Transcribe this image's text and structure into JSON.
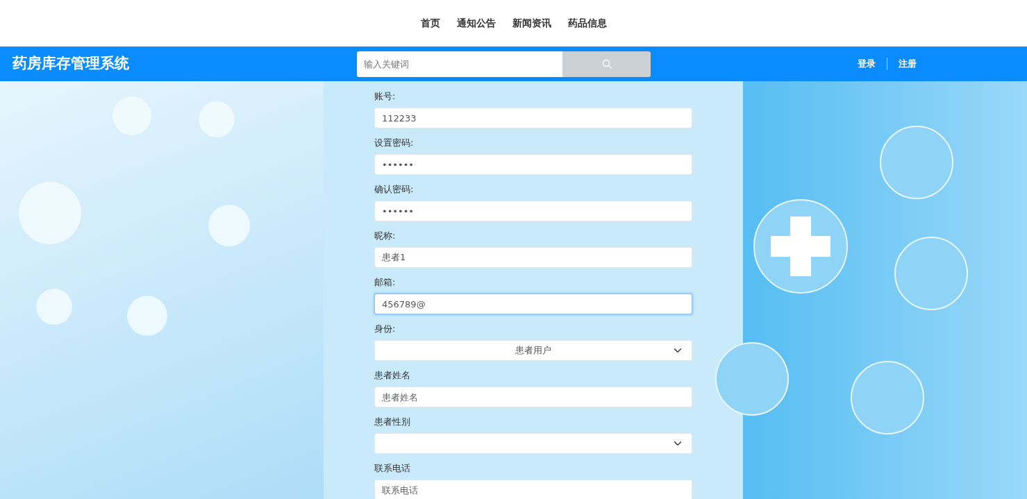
{
  "top_nav": [
    {
      "label": "首页"
    },
    {
      "label": "通知公告"
    },
    {
      "label": "新闻资讯"
    },
    {
      "label": "药品信息"
    }
  ],
  "header": {
    "title": "药房库存管理系统",
    "search": {
      "placeholder": "输入关键词"
    },
    "links": [
      {
        "label": "登录"
      },
      {
        "label": "注册"
      }
    ]
  },
  "form": [
    {
      "kind": "text",
      "label": "账号:",
      "value": "112233",
      "focused": false
    },
    {
      "kind": "text",
      "label": "设置密码:",
      "value": "••••••",
      "focused": false
    },
    {
      "kind": "text",
      "label": "确认密码:",
      "value": "••••••",
      "focused": false
    },
    {
      "kind": "text",
      "label": "昵称:",
      "value": "患者1",
      "focused": false
    },
    {
      "kind": "text",
      "label": "邮箱:",
      "value": "456789@",
      "focused": true
    },
    {
      "kind": "select",
      "label": "身份:",
      "value": "患者用户",
      "focused": false
    },
    {
      "kind": "text",
      "label": "患者姓名",
      "placeholder": "患者姓名",
      "focused": false
    },
    {
      "kind": "select",
      "label": "患者性别",
      "focused": false
    },
    {
      "kind": "text",
      "label": "联系电话",
      "placeholder": "联系电话",
      "focused": false
    }
  ]
}
